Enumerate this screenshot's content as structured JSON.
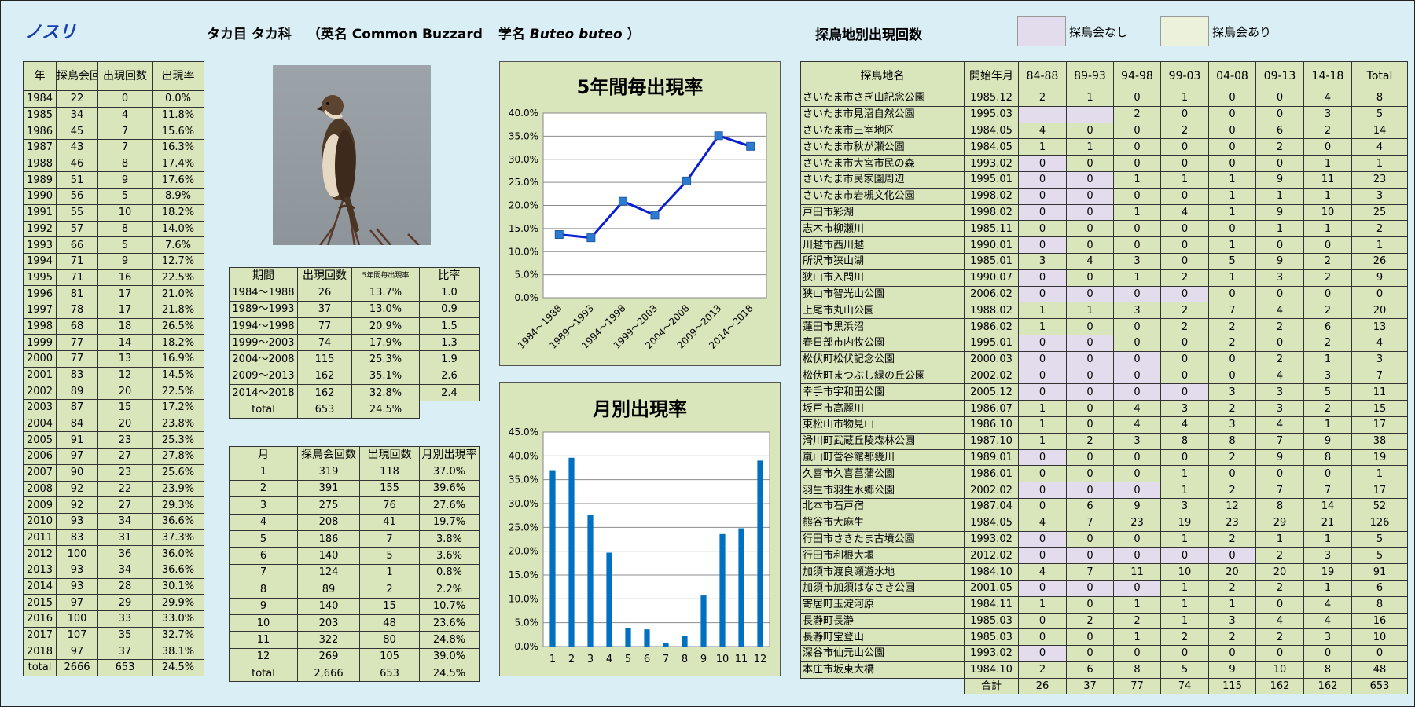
{
  "header": {
    "title": "ノスリ",
    "order": "タカ目",
    "family": "タカ科",
    "en_open": "（英名",
    "en_name": "Common Buzzard",
    "sci_prefix": "学名",
    "sci_name": "Buteo buteo",
    "close": "）",
    "location_title": "探鳥地別出現回数",
    "legend_none": "探鳥会なし",
    "legend_yes": "探鳥会あり"
  },
  "colors": {
    "no_meeting": "#e2dcec",
    "meeting": "#ecf1dc",
    "panel": "#d9e5bb",
    "line": "#0a1fd0",
    "bar": "#0070c0",
    "background": "#daeef5"
  },
  "photo_label": "ノスリ写真",
  "year_table": {
    "headers": [
      "年",
      "探鳥会回数",
      "出現回数",
      "出現率"
    ],
    "rows": [
      [
        "1984",
        "22",
        "0",
        "0.0%"
      ],
      [
        "1985",
        "34",
        "4",
        "11.8%"
      ],
      [
        "1986",
        "45",
        "7",
        "15.6%"
      ],
      [
        "1987",
        "43",
        "7",
        "16.3%"
      ],
      [
        "1988",
        "46",
        "8",
        "17.4%"
      ],
      [
        "1989",
        "51",
        "9",
        "17.6%"
      ],
      [
        "1990",
        "56",
        "5",
        "8.9%"
      ],
      [
        "1991",
        "55",
        "10",
        "18.2%"
      ],
      [
        "1992",
        "57",
        "8",
        "14.0%"
      ],
      [
        "1993",
        "66",
        "5",
        "7.6%"
      ],
      [
        "1994",
        "71",
        "9",
        "12.7%"
      ],
      [
        "1995",
        "71",
        "16",
        "22.5%"
      ],
      [
        "1996",
        "81",
        "17",
        "21.0%"
      ],
      [
        "1997",
        "78",
        "17",
        "21.8%"
      ],
      [
        "1998",
        "68",
        "18",
        "26.5%"
      ],
      [
        "1999",
        "77",
        "14",
        "18.2%"
      ],
      [
        "2000",
        "77",
        "13",
        "16.9%"
      ],
      [
        "2001",
        "83",
        "12",
        "14.5%"
      ],
      [
        "2002",
        "89",
        "20",
        "22.5%"
      ],
      [
        "2003",
        "87",
        "15",
        "17.2%"
      ],
      [
        "2004",
        "84",
        "20",
        "23.8%"
      ],
      [
        "2005",
        "91",
        "23",
        "25.3%"
      ],
      [
        "2006",
        "97",
        "27",
        "27.8%"
      ],
      [
        "2007",
        "90",
        "23",
        "25.6%"
      ],
      [
        "2008",
        "92",
        "22",
        "23.9%"
      ],
      [
        "2009",
        "92",
        "27",
        "29.3%"
      ],
      [
        "2010",
        "93",
        "34",
        "36.6%"
      ],
      [
        "2011",
        "83",
        "31",
        "37.3%"
      ],
      [
        "2012",
        "100",
        "36",
        "36.0%"
      ],
      [
        "2013",
        "93",
        "34",
        "36.6%"
      ],
      [
        "2014",
        "93",
        "28",
        "30.1%"
      ],
      [
        "2015",
        "97",
        "29",
        "29.9%"
      ],
      [
        "2016",
        "100",
        "33",
        "33.0%"
      ],
      [
        "2017",
        "107",
        "35",
        "32.7%"
      ],
      [
        "2018",
        "97",
        "37",
        "38.1%"
      ],
      [
        "total",
        "2666",
        "653",
        "24.5%"
      ]
    ]
  },
  "period_table": {
    "headers": [
      "期間",
      "出現回数",
      "5年間毎出現率",
      "比率"
    ],
    "rows": [
      [
        "1984～1988",
        "26",
        "13.7%",
        "1.0"
      ],
      [
        "1989～1993",
        "37",
        "13.0%",
        "0.9"
      ],
      [
        "1994～1998",
        "77",
        "20.9%",
        "1.5"
      ],
      [
        "1999～2003",
        "74",
        "17.9%",
        "1.3"
      ],
      [
        "2004～2008",
        "115",
        "25.3%",
        "1.9"
      ],
      [
        "2009～2013",
        "162",
        "35.1%",
        "2.6"
      ],
      [
        "2014～2018",
        "162",
        "32.8%",
        "2.4"
      ],
      [
        "total",
        "653",
        "24.5%",
        ""
      ]
    ]
  },
  "month_table": {
    "headers": [
      "月",
      "探鳥会回数",
      "出現回数",
      "月別出現率"
    ],
    "rows": [
      [
        "1",
        "319",
        "118",
        "37.0%"
      ],
      [
        "2",
        "391",
        "155",
        "39.6%"
      ],
      [
        "3",
        "275",
        "76",
        "27.6%"
      ],
      [
        "4",
        "208",
        "41",
        "19.7%"
      ],
      [
        "5",
        "186",
        "7",
        "3.8%"
      ],
      [
        "6",
        "140",
        "5",
        "3.6%"
      ],
      [
        "7",
        "124",
        "1",
        "0.8%"
      ],
      [
        "8",
        "89",
        "2",
        "2.2%"
      ],
      [
        "9",
        "140",
        "15",
        "10.7%"
      ],
      [
        "10",
        "203",
        "48",
        "23.6%"
      ],
      [
        "11",
        "322",
        "80",
        "24.8%"
      ],
      [
        "12",
        "269",
        "105",
        "39.0%"
      ],
      [
        "total",
        "2,666",
        "653",
        "24.5%"
      ]
    ]
  },
  "location_table": {
    "headers": [
      "探鳥地名",
      "開始年月",
      "84-88",
      "89-93",
      "94-98",
      "99-03",
      "04-08",
      "09-13",
      "14-18",
      "Total"
    ],
    "rows": [
      {
        "name": "さいたま市さぎ山記念公園",
        "start": "1985.12",
        "v": [
          "2",
          "1",
          "0",
          "1",
          "0",
          "0",
          "4",
          "8"
        ],
        "gap": []
      },
      {
        "name": "さいたま市見沼自然公園",
        "start": "1995.03",
        "v": [
          "",
          "",
          "2",
          "0",
          "0",
          "0",
          "3",
          "5"
        ],
        "gap": [
          0,
          1
        ]
      },
      {
        "name": "さいたま市三室地区",
        "start": "1984.05",
        "v": [
          "4",
          "0",
          "0",
          "2",
          "0",
          "6",
          "2",
          "14"
        ],
        "gap": []
      },
      {
        "name": "さいたま市秋が瀬公園",
        "start": "1984.05",
        "v": [
          "1",
          "1",
          "0",
          "0",
          "0",
          "2",
          "0",
          "4"
        ],
        "gap": []
      },
      {
        "name": "さいたま市大宮市民の森",
        "start": "1993.02",
        "v": [
          "0",
          "0",
          "0",
          "0",
          "0",
          "0",
          "1",
          "1"
        ],
        "gap": [
          0
        ]
      },
      {
        "name": "さいたま市民家園周辺",
        "start": "1995.01",
        "v": [
          "0",
          "0",
          "1",
          "1",
          "1",
          "9",
          "11",
          "23"
        ],
        "gap": [
          0,
          1
        ]
      },
      {
        "name": "さいたま市岩槻文化公園",
        "start": "1998.02",
        "v": [
          "0",
          "0",
          "0",
          "0",
          "1",
          "1",
          "1",
          "3"
        ],
        "gap": [
          0,
          1
        ]
      },
      {
        "name": "戸田市彩湖",
        "start": "1998.02",
        "v": [
          "0",
          "0",
          "1",
          "4",
          "1",
          "9",
          "10",
          "25"
        ],
        "gap": [
          0,
          1
        ]
      },
      {
        "name": "志木市柳瀬川",
        "start": "1985.11",
        "v": [
          "0",
          "0",
          "0",
          "0",
          "0",
          "1",
          "1",
          "2"
        ],
        "gap": []
      },
      {
        "name": "川越市西川越",
        "start": "1990.01",
        "v": [
          "0",
          "0",
          "0",
          "0",
          "1",
          "0",
          "0",
          "1"
        ],
        "gap": [
          0
        ]
      },
      {
        "name": "所沢市狭山湖",
        "start": "1985.01",
        "v": [
          "3",
          "4",
          "3",
          "0",
          "5",
          "9",
          "2",
          "26"
        ],
        "gap": []
      },
      {
        "name": "狭山市入間川",
        "start": "1990.07",
        "v": [
          "0",
          "0",
          "1",
          "2",
          "1",
          "3",
          "2",
          "9"
        ],
        "gap": [
          0
        ]
      },
      {
        "name": "狭山市智光山公園",
        "start": "2006.02",
        "v": [
          "0",
          "0",
          "0",
          "0",
          "0",
          "0",
          "0",
          "0"
        ],
        "gap": [
          0,
          1,
          2,
          3
        ]
      },
      {
        "name": "上尾市丸山公園",
        "start": "1988.02",
        "v": [
          "1",
          "1",
          "3",
          "2",
          "7",
          "4",
          "2",
          "20"
        ],
        "gap": []
      },
      {
        "name": "蓮田市黒浜沼",
        "start": "1986.02",
        "v": [
          "1",
          "0",
          "0",
          "2",
          "2",
          "2",
          "6",
          "13"
        ],
        "gap": []
      },
      {
        "name": "春日部市内牧公園",
        "start": "1995.01",
        "v": [
          "0",
          "0",
          "0",
          "0",
          "2",
          "0",
          "2",
          "4"
        ],
        "gap": [
          0,
          1
        ]
      },
      {
        "name": "松伏町松伏記念公園",
        "start": "2000.03",
        "v": [
          "0",
          "0",
          "0",
          "0",
          "0",
          "2",
          "1",
          "3"
        ],
        "gap": [
          0,
          1,
          2
        ]
      },
      {
        "name": "松伏町まつぶし緑の丘公園",
        "start": "2002.02",
        "v": [
          "0",
          "0",
          "0",
          "0",
          "0",
          "4",
          "3",
          "7"
        ],
        "gap": [
          0,
          1,
          2
        ]
      },
      {
        "name": "幸手市宇和田公園",
        "start": "2005.12",
        "v": [
          "0",
          "0",
          "0",
          "0",
          "3",
          "3",
          "5",
          "11"
        ],
        "gap": [
          0,
          1,
          2,
          3
        ]
      },
      {
        "name": "坂戸市高麗川",
        "start": "1986.07",
        "v": [
          "1",
          "0",
          "4",
          "3",
          "2",
          "3",
          "2",
          "15"
        ],
        "gap": []
      },
      {
        "name": "東松山市物見山",
        "start": "1986.10",
        "v": [
          "1",
          "0",
          "4",
          "4",
          "3",
          "4",
          "1",
          "17"
        ],
        "gap": []
      },
      {
        "name": "滑川町武蔵丘陵森林公園",
        "start": "1987.10",
        "v": [
          "1",
          "2",
          "3",
          "8",
          "8",
          "7",
          "9",
          "38"
        ],
        "gap": []
      },
      {
        "name": "嵐山町菅谷館都幾川",
        "start": "1989.01",
        "v": [
          "0",
          "0",
          "0",
          "0",
          "2",
          "9",
          "8",
          "19"
        ],
        "gap": [
          0
        ]
      },
      {
        "name": "久喜市久喜菖蒲公園",
        "start": "1986.01",
        "v": [
          "0",
          "0",
          "0",
          "1",
          "0",
          "0",
          "0",
          "1"
        ],
        "gap": []
      },
      {
        "name": "羽生市羽生水郷公園",
        "start": "2002.02",
        "v": [
          "0",
          "0",
          "0",
          "1",
          "2",
          "7",
          "7",
          "17"
        ],
        "gap": [
          0,
          1,
          2
        ]
      },
      {
        "name": "北本市石戸宿",
        "start": "1987.04",
        "v": [
          "0",
          "6",
          "9",
          "3",
          "12",
          "8",
          "14",
          "52"
        ],
        "gap": []
      },
      {
        "name": "熊谷市大麻生",
        "start": "1984.05",
        "v": [
          "4",
          "7",
          "23",
          "19",
          "23",
          "29",
          "21",
          "126"
        ],
        "gap": []
      },
      {
        "name": "行田市さきたま古墳公園",
        "start": "1993.02",
        "v": [
          "0",
          "0",
          "0",
          "1",
          "2",
          "1",
          "1",
          "5"
        ],
        "gap": [
          0
        ]
      },
      {
        "name": "行田市利根大堰",
        "start": "2012.02",
        "v": [
          "0",
          "0",
          "0",
          "0",
          "0",
          "2",
          "3",
          "5"
        ],
        "gap": [
          0,
          1,
          2,
          3,
          4
        ]
      },
      {
        "name": "加須市渡良瀬遊水地",
        "start": "1984.10",
        "v": [
          "4",
          "7",
          "11",
          "10",
          "20",
          "20",
          "19",
          "91"
        ],
        "gap": []
      },
      {
        "name": "加須市加須はなさき公園",
        "start": "2001.05",
        "v": [
          "0",
          "0",
          "0",
          "1",
          "2",
          "2",
          "1",
          "6"
        ],
        "gap": [
          0,
          1,
          2
        ]
      },
      {
        "name": "寄居町玉淀河原",
        "start": "1984.11",
        "v": [
          "1",
          "0",
          "1",
          "1",
          "1",
          "0",
          "4",
          "8"
        ],
        "gap": []
      },
      {
        "name": "長瀞町長瀞",
        "start": "1985.03",
        "v": [
          "0",
          "2",
          "2",
          "1",
          "3",
          "4",
          "4",
          "16"
        ],
        "gap": []
      },
      {
        "name": "長瀞町宝登山",
        "start": "1985.03",
        "v": [
          "0",
          "0",
          "1",
          "2",
          "2",
          "2",
          "3",
          "10"
        ],
        "gap": []
      },
      {
        "name": "深谷市仙元山公園",
        "start": "1993.02",
        "v": [
          "0",
          "0",
          "0",
          "0",
          "0",
          "0",
          "0",
          "0"
        ],
        "gap": [
          0
        ]
      },
      {
        "name": "本庄市坂東大橋",
        "start": "1984.10",
        "v": [
          "2",
          "6",
          "8",
          "5",
          "9",
          "10",
          "8",
          "48"
        ],
        "gap": []
      }
    ],
    "total_label": "合計",
    "totals": [
      "26",
      "37",
      "77",
      "74",
      "115",
      "162",
      "162",
      "653"
    ]
  },
  "chart_data": [
    {
      "type": "line",
      "title": "5年間毎出現率",
      "categories": [
        "1984～1988",
        "1989～1993",
        "1994～1998",
        "1999～2003",
        "2004～2008",
        "2009～2013",
        "2014～2018"
      ],
      "values": [
        13.7,
        13.0,
        20.9,
        17.9,
        25.3,
        35.1,
        32.8
      ],
      "ylim": [
        0,
        40
      ],
      "yticks": [
        "0.0%",
        "5.0%",
        "10.0%",
        "15.0%",
        "20.0%",
        "25.0%",
        "30.0%",
        "35.0%",
        "40.0%"
      ],
      "grid": true
    },
    {
      "type": "bar",
      "title": "月別出現率",
      "categories": [
        "1",
        "2",
        "3",
        "4",
        "5",
        "6",
        "7",
        "8",
        "9",
        "10",
        "11",
        "12"
      ],
      "values": [
        37.0,
        39.6,
        27.6,
        19.7,
        3.8,
        3.6,
        0.8,
        2.2,
        10.7,
        23.6,
        24.8,
        39.0
      ],
      "ylim": [
        0,
        45
      ],
      "yticks": [
        "0.0%",
        "5.0%",
        "10.0%",
        "15.0%",
        "20.0%",
        "25.0%",
        "30.0%",
        "35.0%",
        "40.0%",
        "45.0%"
      ],
      "grid": true
    }
  ]
}
